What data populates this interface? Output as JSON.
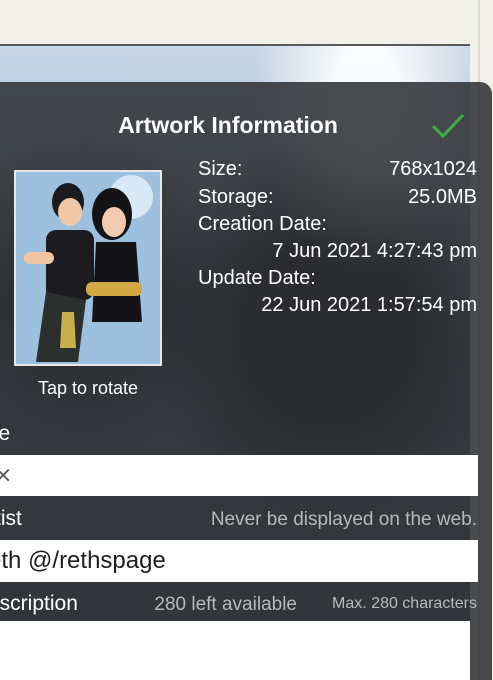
{
  "dialog": {
    "title": "Artwork Information",
    "confirm_icon": "checkmark-icon",
    "accent_color": "#3cb043"
  },
  "thumbnail": {
    "rotate_label": "Tap to rotate"
  },
  "info": {
    "size_label": "Size:",
    "size_value": "768x1024",
    "storage_label": "Storage:",
    "storage_value": "25.0MB",
    "creation_label": "Creation Date:",
    "creation_value": "7 Jun 2021 4:27:43 pm",
    "update_label": "Update Date:",
    "update_value": "22 Jun 2021 1:57:54 pm"
  },
  "fields": {
    "title_label": "tle",
    "title_value": "⨯",
    "artist_label": "rtist",
    "artist_hint": "Never be displayed on the web.",
    "artist_value": "eth @/rethspage",
    "description_label": "escription",
    "description_remaining": "280 left available",
    "description_max": "Max. 280 characters"
  }
}
